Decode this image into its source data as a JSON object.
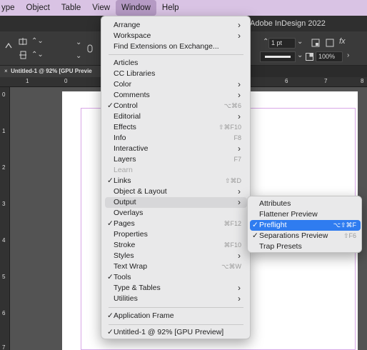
{
  "menubar": {
    "items": [
      "ype",
      "Object",
      "Table",
      "View",
      "Window",
      "Help"
    ],
    "active_index": 4
  },
  "app": {
    "title": "Adobe InDesign 2022",
    "controls": {
      "stroke_weight": "1 pt",
      "zoom": "100%",
      "function_icon": "fx"
    },
    "doc_tab": "Untitled-1 @ 92% [GPU Previe",
    "doc_tab_close": "×",
    "ruler_top": [
      "1",
      "0",
      "6",
      "7",
      "8"
    ],
    "ruler_left": [
      "0",
      "1",
      "2",
      "3",
      "4",
      "5",
      "6",
      "7"
    ]
  },
  "window_menu": {
    "items": [
      {
        "label": "Arrange",
        "submenu": true
      },
      {
        "label": "Workspace",
        "submenu": true
      },
      {
        "label": "Find Extensions on Exchange..."
      },
      {
        "separator": true
      },
      {
        "label": "Articles"
      },
      {
        "label": "CC Libraries"
      },
      {
        "label": "Color",
        "submenu": true
      },
      {
        "label": "Comments",
        "submenu": true
      },
      {
        "label": "Control",
        "checked": true,
        "shortcut": "⌥⌘6"
      },
      {
        "label": "Editorial",
        "submenu": true
      },
      {
        "label": "Effects",
        "shortcut": "⇧⌘F10"
      },
      {
        "label": "Info",
        "shortcut": "F8"
      },
      {
        "label": "Interactive",
        "submenu": true
      },
      {
        "label": "Layers",
        "shortcut": "F7"
      },
      {
        "label": "Learn",
        "disabled": true
      },
      {
        "label": "Links",
        "checked": true,
        "shortcut": "⇧⌘D"
      },
      {
        "label": "Object & Layout",
        "submenu": true
      },
      {
        "label": "Output",
        "submenu": true,
        "highlighted": true
      },
      {
        "label": "Overlays"
      },
      {
        "label": "Pages",
        "checked": true,
        "shortcut": "⌘F12"
      },
      {
        "label": "Properties"
      },
      {
        "label": "Stroke",
        "shortcut": "⌘F10"
      },
      {
        "label": "Styles",
        "submenu": true
      },
      {
        "label": "Text Wrap",
        "shortcut": "⌥⌘W"
      },
      {
        "label": "Tools",
        "checked": true
      },
      {
        "label": "Type & Tables",
        "submenu": true
      },
      {
        "label": "Utilities",
        "submenu": true
      },
      {
        "separator": true
      },
      {
        "label": "Application Frame",
        "checked": true
      },
      {
        "separator": true
      },
      {
        "label": "Untitled-1 @ 92% [GPU Preview]",
        "checked": true
      }
    ]
  },
  "output_submenu": {
    "items": [
      {
        "label": "Attributes"
      },
      {
        "label": "Flattener Preview"
      },
      {
        "label": "Preflight",
        "checked": true,
        "shortcut": "⌥⇧⌘F",
        "selected": true
      },
      {
        "label": "Separations Preview",
        "checked": true,
        "shortcut": "⇧F6"
      },
      {
        "label": "Trap Presets"
      }
    ]
  },
  "colors": {
    "menubar_bg": "#d9c3e4",
    "selection_blue": "#2f7cf0",
    "margin_guide": "#d9a7e7"
  }
}
